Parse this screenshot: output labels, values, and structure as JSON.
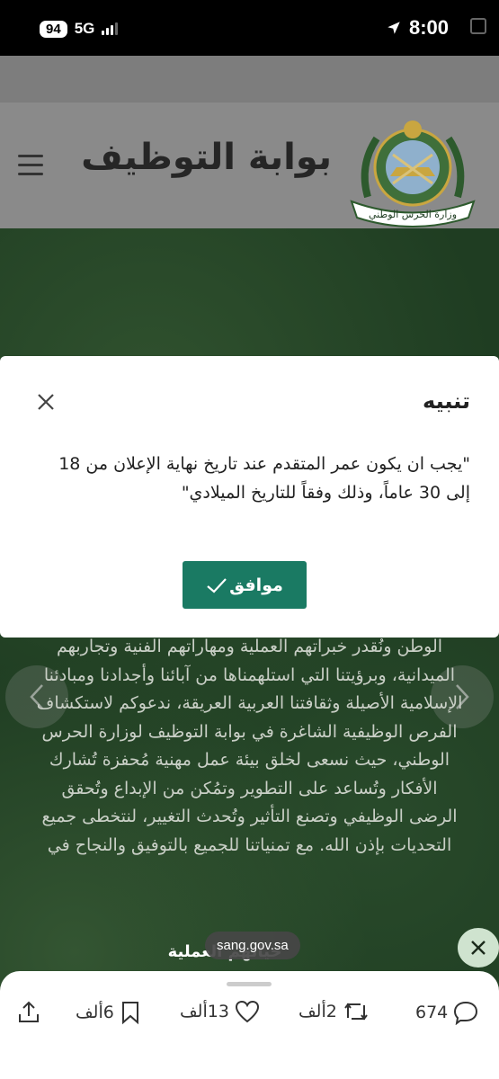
{
  "status_bar": {
    "battery": "94",
    "network": "5G",
    "time": "8:00"
  },
  "header": {
    "site_title": "بوابة التوظيف",
    "logo_text": "وزارة الحرس الوطني"
  },
  "background": {
    "paragraph": "الوطن ونُقدر خبراتهم العملية ومهاراتهم الفنية وتجاربهم الميدانية، وبرؤيتنا التي استلهمناها من آبائنا وأجدادنا ومبادئنا الإسلامية الأصيلة وثقافتنا العربية العريقة، ندعوكم لاستكشاف الفرص الوظيفية الشاغرة في بوابة التوظيف لوزارة الحرس الوطني، حيث نسعى لخلق بيئة عمل مهنية مُحفزة تُشارك الأفكار وتُساعد على التطوير وتمُكن من الإبداع وتُحقق الرضى الوظيفي وتصنع التأثير وتُحدث التغيير، لنتخطى جميع التحديات بإذن الله. مع تمنياتنا للجميع بالتوفيق والنجاح في",
    "caption": "حياتهم العملية"
  },
  "modal": {
    "title": "تنبيه",
    "message": "\"يجب ان يكون عمر المتقدم عند تاريخ نهاية الإعلان من 18 إلى 30 عاماً، وذلك وفقاً للتاريخ الميلادي\"",
    "ok_label": "موافق"
  },
  "url_pill": "sang.gov.sa",
  "actions": {
    "share": "",
    "bookmarks": "6ألف",
    "likes": "13ألف",
    "reposts": "2ألف",
    "replies": "674"
  },
  "colors": {
    "accent": "#1a7a63",
    "background_green": "#1f3d22"
  }
}
